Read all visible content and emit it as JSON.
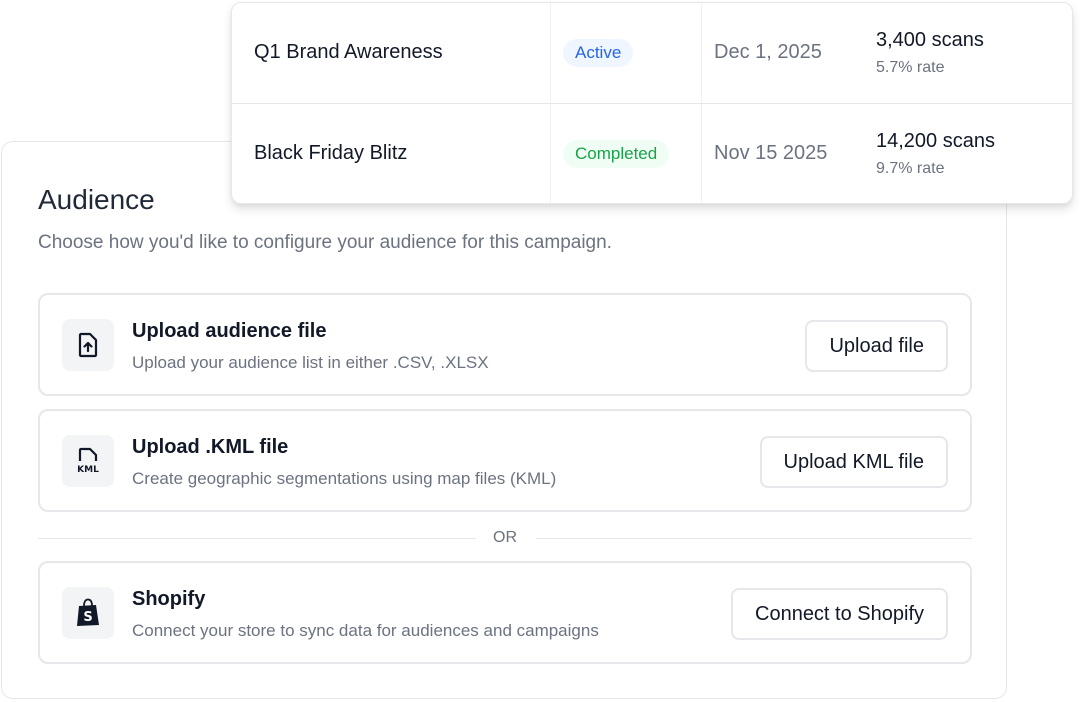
{
  "campaigns": {
    "rows": [
      {
        "name": "Q1 Brand Awareness",
        "status": "Active",
        "status_color": "#2563eb",
        "status_bg": "#eff6ff",
        "date": "Dec 1, 2025",
        "scans": "3,400 scans",
        "rate": "5.7% rate"
      },
      {
        "name": "Black Friday Blitz",
        "status": "Completed",
        "status_color": "#16a34a",
        "status_bg": "#f0fdf4",
        "date": "Nov 15 2025",
        "scans": "14,200 scans",
        "rate": "9.7% rate"
      }
    ]
  },
  "audience": {
    "title": "Audience",
    "subtitle": "Choose how you'd like to configure your audience for this campaign.",
    "options": [
      {
        "icon": "file-upload-icon",
        "title": "Upload audience file",
        "description": "Upload your audience list in either .CSV, .XLSX",
        "button": "Upload file"
      },
      {
        "icon": "kml-file-icon",
        "title": "Upload .KML file",
        "description": "Create geographic segmentations using map files (KML)",
        "button": "Upload KML file"
      },
      {
        "icon": "shopify-bag-icon",
        "title": "Shopify",
        "description": "Connect your store to sync data for audiences and campaigns",
        "button": "Connect to Shopify"
      }
    ],
    "divider_text": "OR"
  }
}
